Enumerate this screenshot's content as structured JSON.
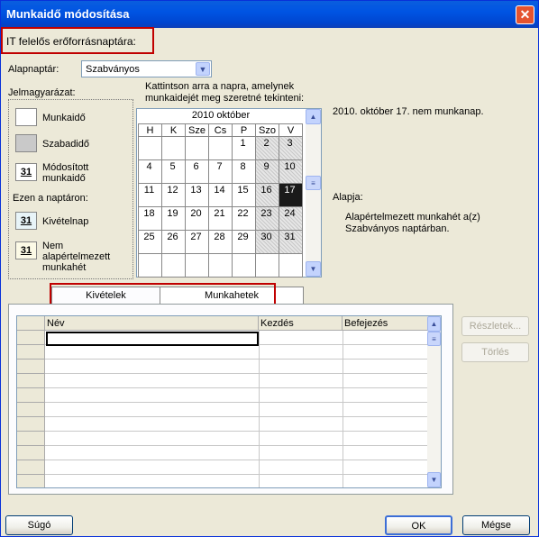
{
  "window": {
    "title": "Munkaidő módosítása",
    "close_label": "✕"
  },
  "calendar_for_label": "IT felelős erőforrásnaptára:",
  "base_calendar": {
    "label": "Alapnaptár:",
    "value": "Szabványos"
  },
  "legend": {
    "title": "Jelmagyarázat:",
    "items": [
      {
        "label": "Munkaidő"
      },
      {
        "label": "Szabadidő"
      },
      {
        "label": "Módosított munkaidő",
        "num": "31"
      }
    ],
    "on_calendar": "Ezen a naptáron:",
    "items2": [
      {
        "label": "Kivételnap",
        "num": "31"
      },
      {
        "label": "Nem alapértelmezett munkahét",
        "num": "31"
      }
    ]
  },
  "instruction": "Kattintson arra a napra, amelynek munkaidejét meg szeretné tekinteni:",
  "calendar": {
    "month": "2010 október",
    "days": [
      "H",
      "K",
      "Sze",
      "Cs",
      "P",
      "Szo",
      "V"
    ],
    "weeks": [
      [
        "",
        "",
        "",
        "",
        "1",
        "2",
        "3"
      ],
      [
        "4",
        "5",
        "6",
        "7",
        "8",
        "9",
        "10"
      ],
      [
        "11",
        "12",
        "13",
        "14",
        "15",
        "16",
        "17"
      ],
      [
        "18",
        "19",
        "20",
        "21",
        "22",
        "23",
        "24"
      ],
      [
        "25",
        "26",
        "27",
        "28",
        "29",
        "30",
        "31"
      ],
      [
        "",
        "",
        "",
        "",
        "",
        "",
        ""
      ]
    ]
  },
  "info": {
    "status": "2010. október 17. nem munkanap.",
    "basis_label": "Alapja:",
    "basis_text": "Alapértelmezett munkahét a(z) Szabványos naptárban."
  },
  "tabs": [
    {
      "label": "Kivételek"
    },
    {
      "label": "Munkahetek"
    }
  ],
  "grid": {
    "columns": [
      "Név",
      "Kezdés",
      "Befejezés"
    ]
  },
  "buttons": {
    "details": "Részletek...",
    "delete": "Törlés",
    "help": "Súgó",
    "ok": "OK",
    "cancel": "Mégse"
  }
}
